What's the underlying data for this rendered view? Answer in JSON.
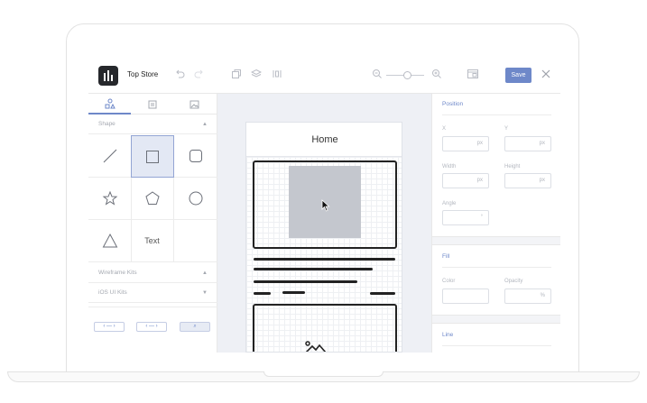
{
  "toolbar": {
    "project_title": "Top Store",
    "save_label": "Save"
  },
  "left_panel": {
    "tabs": [
      "shapes-tab",
      "components-tab",
      "images-tab"
    ],
    "shape_section": "Shape",
    "text_tool": "Text",
    "wireframe_kits": "Wireframe Kits",
    "ios_kits": "iOS UI Kits"
  },
  "canvas": {
    "screen_title": "Home"
  },
  "right_panel": {
    "position": {
      "heading": "Position",
      "x_label": "X",
      "y_label": "Y",
      "x_unit": "px",
      "y_unit": "px",
      "width_label": "Width",
      "height_label": "Height",
      "width_unit": "px",
      "height_unit": "px",
      "angle_label": "Angle",
      "angle_unit": "°"
    },
    "fill": {
      "heading": "Fill",
      "color_label": "Color",
      "opacity_label": "Opacity",
      "opacity_unit": "%"
    },
    "line": {
      "heading": "Line"
    }
  },
  "colors": {
    "accent": "#6e88c9",
    "logo": "#26282c",
    "canvas_bg": "#eef0f5",
    "placeholder": "#c4c7ce"
  }
}
